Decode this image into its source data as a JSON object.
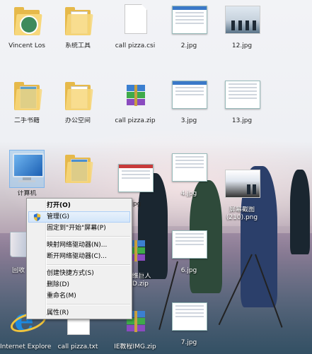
{
  "desktop": {
    "icons": [
      {
        "key": "vincent",
        "label": "Vincent Los"
      },
      {
        "key": "systools",
        "label": "系统工具"
      },
      {
        "key": "callpizza_csi",
        "label": "call pizza.csi"
      },
      {
        "key": "img2",
        "label": "2.jpg"
      },
      {
        "key": "img12",
        "label": "12.jpg"
      },
      {
        "key": "books",
        "label": "二手书籍"
      },
      {
        "key": "office",
        "label": "办公空间"
      },
      {
        "key": "callpizza_zip",
        "label": "call pizza.zip"
      },
      {
        "key": "img3",
        "label": "3.jpg"
      },
      {
        "key": "img13",
        "label": "13.jpg"
      },
      {
        "key": "computer",
        "label": "计算机"
      },
      {
        "key": "folder_h",
        "label": ""
      },
      {
        "key": "img_partial",
        "label": ".jpg"
      },
      {
        "key": "img4",
        "label": "4.jpg"
      },
      {
        "key": "screenshot210",
        "label": "屏幕截图\n(210).png"
      },
      {
        "key": "recycle",
        "label": "回收"
      },
      {
        "key": "zip_mid",
        "label": "刘斯维巨人\nMOD.zip"
      },
      {
        "key": "img6",
        "label": "6.jpg"
      },
      {
        "key": "ie",
        "label": "Internet Explorer"
      },
      {
        "key": "callpizza_txt",
        "label": "call pizza.txt"
      },
      {
        "key": "zip_bottom",
        "label": "IE教程IMG.zip"
      },
      {
        "key": "img7",
        "label": "7.jpg"
      }
    ]
  },
  "context_menu": {
    "items": [
      {
        "label": "打开(O)",
        "bold": true
      },
      {
        "label": "管理(G)",
        "highlighted": true,
        "icon": "shield-icon"
      },
      {
        "label": "固定到\"开始\"屏幕(P)"
      },
      {
        "sep": true
      },
      {
        "label": "映射网络驱动器(N)..."
      },
      {
        "label": "断开网络驱动器(C)..."
      },
      {
        "sep": true
      },
      {
        "label": "创建快捷方式(S)"
      },
      {
        "label": "删除(D)"
      },
      {
        "label": "重命名(M)"
      },
      {
        "sep": true
      },
      {
        "label": "属性(R)"
      }
    ]
  },
  "colors": {
    "menu_bg": "#f0f0f0",
    "highlight_border": "#aecff7",
    "folder": "#f7d77b"
  }
}
